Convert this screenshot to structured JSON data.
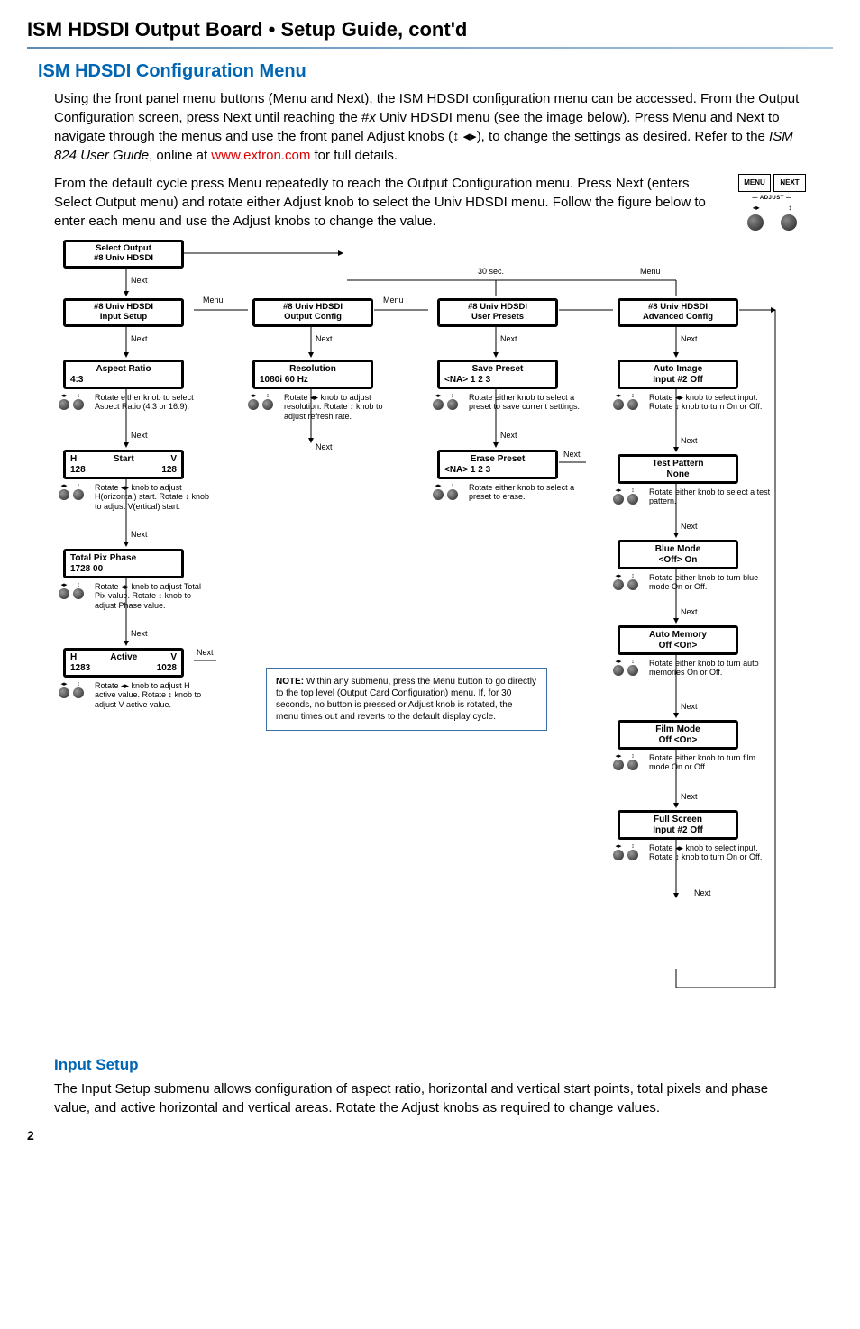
{
  "page_title": "ISM HDSDI Output Board • Setup Guide, cont'd",
  "section_heading": "ISM HDSDI Configuration Menu",
  "para1_a": "Using the front panel menu buttons (Menu and Next), the ISM HDSDI configuration menu can be accessed. From the Output Configuration screen, press Next until reaching the #",
  "para1_i": "x",
  "para1_b": " Univ HDSDI menu (see the image below). Press Menu and Next to navigate through the menus and use the front panel Adjust knobs (↕ ◂▸), to change the settings as desired. Refer to the ",
  "para1_guide": "ISM 824 User Guide",
  "para1_c": ", online at ",
  "para1_link": "www.extron.com",
  "para1_d": " for full details.",
  "para2": "From the default cycle press Menu repeatedly to reach the Output Configuration menu. Press Next (enters Select Output menu) and rotate either Adjust knob to select the Univ HDSDI menu. Follow the figure below to enter each menu and use the Adjust knobs to change the value.",
  "buttons": {
    "menu": "MENU",
    "next": "NEXT",
    "adjust": "ADJUST"
  },
  "diagram": {
    "select_output": {
      "l1": "Select Output",
      "l2": "#8  Univ HDSDI"
    },
    "col1": {
      "header": {
        "l1": "#8   Univ HDSDI",
        "l2": "Input Setup"
      },
      "aspect": {
        "l1": "Aspect Ratio",
        "l2": "4:3"
      },
      "aspect_desc": "Rotate either knob to select Aspect Ratio (4:3 or 16:9).",
      "start": {
        "h": "H",
        "title": "Start",
        "v": "V",
        "hv": "128",
        "vv": "128"
      },
      "start_desc": "Rotate ◂▸ knob to adjust H(orizontal) start. Rotate ↕ knob to adjust V(ertical) start.",
      "totalpix": {
        "l1": "Total Pix     Phase",
        "l2": "1728           00"
      },
      "totalpix_desc": "Rotate ◂▸ knob to adjust Total Pix value. Rotate ↕ knob to adjust Phase value.",
      "active": {
        "h": "H",
        "title": "Active",
        "v": "V",
        "hv": "1283",
        "vv": "1028"
      },
      "active_desc": "Rotate ◂▸ knob to adjust H active value. Rotate ↕ knob to adjust V active value."
    },
    "col2": {
      "header": {
        "l1": "#8   Univ HDSDI",
        "l2": "Output Config"
      },
      "resolution": {
        "l1": "Resolution",
        "l2": "1080i   60 Hz"
      },
      "resolution_desc": "Rotate ◂▸ knob to adjust resolution. Rotate ↕ knob to adjust refresh rate."
    },
    "col3": {
      "header": {
        "l1": "#8   Univ HDSDI",
        "l2": "User Presets"
      },
      "save": {
        "l1": "Save Preset",
        "l2": "<NA>   1   2   3"
      },
      "save_desc": "Rotate either knob to select a preset to save current settings.",
      "erase": {
        "l1": "Erase Preset",
        "l2": "<NA>   1   2   3"
      },
      "erase_desc": "Rotate either knob to select a preset to erase."
    },
    "col4": {
      "header": {
        "l1": "#8   Univ HDSDI",
        "l2": "Advanced Config"
      },
      "autoimage": {
        "l1": "Auto Image",
        "l2": "Input #2 Off"
      },
      "autoimage_desc": "Rotate ◂▸ knob to select input. Rotate ↕ knob to turn On or Off.",
      "testpattern": {
        "l1": "Test Pattern",
        "l2": "None"
      },
      "testpattern_desc": "Rotate either knob to select a test pattern.",
      "bluemode": {
        "l1": "Blue Mode",
        "l2": "<Off>   On"
      },
      "bluemode_desc": "Rotate either knob to turn blue mode On or Off.",
      "automemory": {
        "l1": "Auto Memory",
        "l2": "Off   <On>"
      },
      "automemory_desc": "Rotate either knob to turn auto memories On or Off.",
      "filmmode": {
        "l1": "Film Mode",
        "l2": "Off   <On>"
      },
      "filmmode_desc": "Rotate either knob to turn film mode On or Off.",
      "fullscreen": {
        "l1": "Full Screen",
        "l2": "Input #2 Off"
      },
      "fullscreen_desc": "Rotate ◂▸ knob to select input. Rotate ↕ knob to turn On or Off."
    },
    "labels": {
      "next": "Next",
      "menu": "Menu",
      "t30": "30 sec."
    },
    "note": {
      "label": "NOTE:",
      "text": "Within any submenu, press the Menu button to go directly to the top level (Output Card Configuration) menu. If, for 30 seconds, no button is pressed or Adjust knob is rotated, the menu times out and reverts to the default display cycle."
    }
  },
  "subsection_heading": "Input Setup",
  "para3": "The Input Setup submenu allows configuration of aspect ratio, horizontal and vertical start points, total pixels and phase value, and active horizontal and vertical areas. Rotate the Adjust knobs as required to change values.",
  "page_num": "2"
}
